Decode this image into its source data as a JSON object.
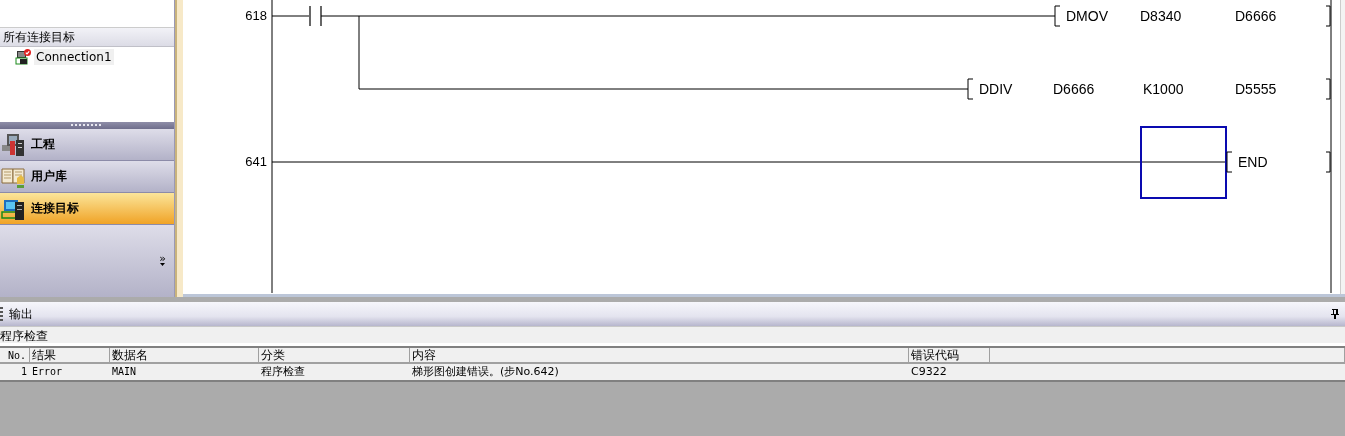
{
  "sidebar": {
    "section_title": "所有连接目标",
    "tree": [
      {
        "label": "Connection1"
      }
    ],
    "nav": [
      {
        "label": "工程",
        "kind": "project",
        "selected": false
      },
      {
        "label": "用户库",
        "kind": "library",
        "selected": false
      },
      {
        "label": "连接目标",
        "kind": "connection",
        "selected": true
      }
    ],
    "more": "»"
  },
  "ladder": {
    "lines": [
      {
        "step": "618",
        "contact": true,
        "instruction": [
          "DMOV",
          "D8340",
          "D6666"
        ]
      },
      {
        "branch": true,
        "instruction": [
          "DDIV",
          "D6666",
          "K1000",
          "D5555"
        ]
      },
      {
        "step": "641",
        "cursor": true,
        "instruction": [
          "END"
        ]
      }
    ]
  },
  "output": {
    "title": "输出",
    "subtitle": "程序检查",
    "table": {
      "columns": [
        "No.",
        "结果",
        "数据名",
        "分类",
        "内容",
        "错误代码"
      ],
      "rows": [
        [
          "1",
          "Error",
          "MAIN",
          "程序检查",
          "梯形图创建错误。(步No.642)",
          "C9322"
        ]
      ]
    }
  }
}
